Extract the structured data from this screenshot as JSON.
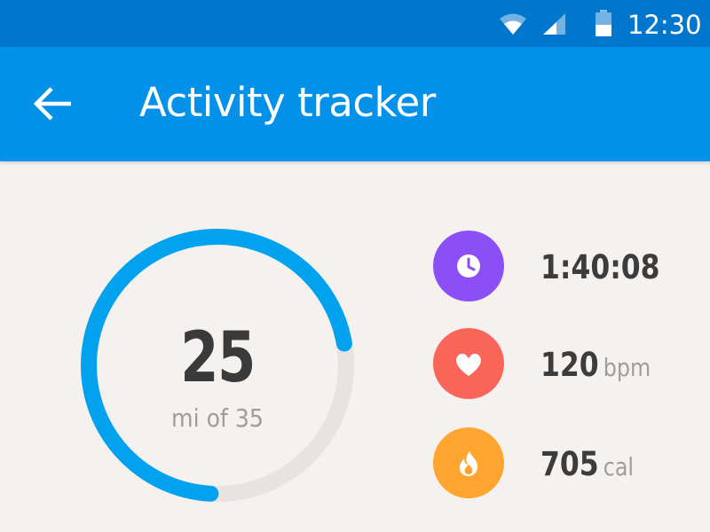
{
  "status_bar": {
    "time": "12:30",
    "icons": [
      "wifi-icon",
      "cell-signal-icon",
      "battery-icon"
    ]
  },
  "app_bar": {
    "title": "Activity tracker",
    "back_icon": "arrow-back-icon"
  },
  "progress": {
    "value": "25",
    "subtitle": "mi of 35",
    "current": 25,
    "goal": 35,
    "track_color": "#e6e3e1",
    "fill_color": "#03a2ee"
  },
  "metrics": [
    {
      "icon": "clock-icon",
      "color": "#8c4ff5",
      "value": "1:40:08",
      "unit": ""
    },
    {
      "icon": "heart-icon",
      "color": "#fa6559",
      "value": "120",
      "unit": "bpm"
    },
    {
      "icon": "flame-icon",
      "color": "#ffa530",
      "value": "705",
      "unit": "cal"
    }
  ],
  "colors": {
    "status_bar": "#0076cc",
    "app_bar": "#0391ea",
    "background": "#f4f1ee"
  }
}
